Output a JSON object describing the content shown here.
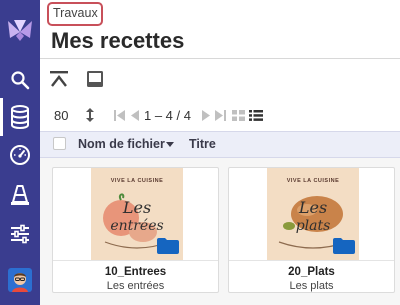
{
  "header": {
    "breadcrumb": "Travaux",
    "title": "Mes recettes"
  },
  "sidebar": {
    "items": [
      {
        "icon": "logo-icon"
      },
      {
        "icon": "search-icon"
      },
      {
        "icon": "database-icon"
      },
      {
        "icon": "gauge-icon"
      },
      {
        "icon": "traffic-cone-icon"
      },
      {
        "icon": "sliders-icon"
      },
      {
        "icon": "avatar"
      }
    ]
  },
  "pager": {
    "page_size": "80",
    "range": "1 – 4 / 4"
  },
  "columns": {
    "name": "Nom de fichier",
    "title": "Titre"
  },
  "cards": [
    {
      "name": "10_Entrees",
      "title": "Les entrées",
      "thumb_caption": "VIVE LA CUISINE",
      "thumb_script_1": "Les",
      "thumb_script_2": "entrées"
    },
    {
      "name": "20_Plats",
      "title": "Les plats",
      "thumb_caption": "VIVE LA CUISINE",
      "thumb_script_1": "Les",
      "thumb_script_2": "plats"
    }
  ],
  "colors": {
    "sidebar": "#3a3d8f",
    "accent": "#c8505a",
    "folder": "#1565c0",
    "header_bg": "#eceef8"
  }
}
